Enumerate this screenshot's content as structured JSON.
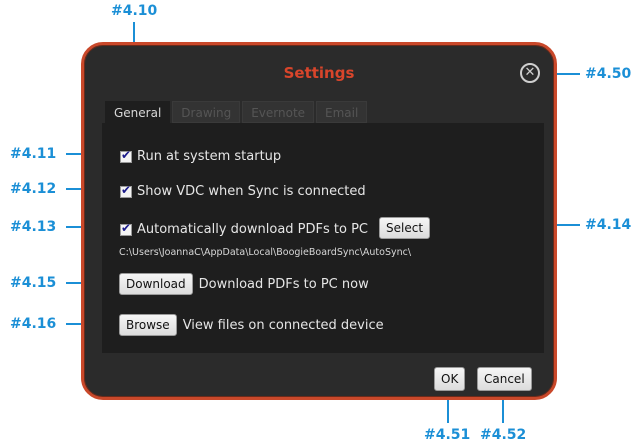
{
  "callouts": {
    "c4_10": "#4.10",
    "c4_11": "#4.11",
    "c4_12": "#4.12",
    "c4_13": "#4.13",
    "c4_14": "#4.14",
    "c4_15": "#4.15",
    "c4_16": "#4.16",
    "c4_50": "#4.50",
    "c4_51": "#4.51",
    "c4_52": "#4.52"
  },
  "dialog": {
    "title": "Settings",
    "close_icon": "close-icon",
    "tabs": [
      {
        "label": "General",
        "active": true
      },
      {
        "label": "Drawing",
        "active": false
      },
      {
        "label": "Evernote",
        "active": false
      },
      {
        "label": "Email",
        "active": false
      }
    ],
    "general": {
      "run_at_startup": {
        "label": "Run at system startup",
        "checked": true
      },
      "show_vdc": {
        "label": "Show VDC when Sync is connected",
        "checked": true
      },
      "auto_download": {
        "label": "Automatically download PDFs to PC",
        "checked": true
      },
      "select_label": "Select",
      "path": "C:\\Users\\JoannaC\\AppData\\Local\\BoogieBoardSync\\AutoSync\\",
      "download_label": "Download",
      "download_text": "Download PDFs to PC now",
      "browse_label": "Browse",
      "browse_text": "View files on connected device"
    },
    "ok_label": "OK",
    "cancel_label": "Cancel"
  },
  "colors": {
    "callout": "#1b8fd6",
    "dialog_border": "#c9482a",
    "title": "#d9452b"
  }
}
